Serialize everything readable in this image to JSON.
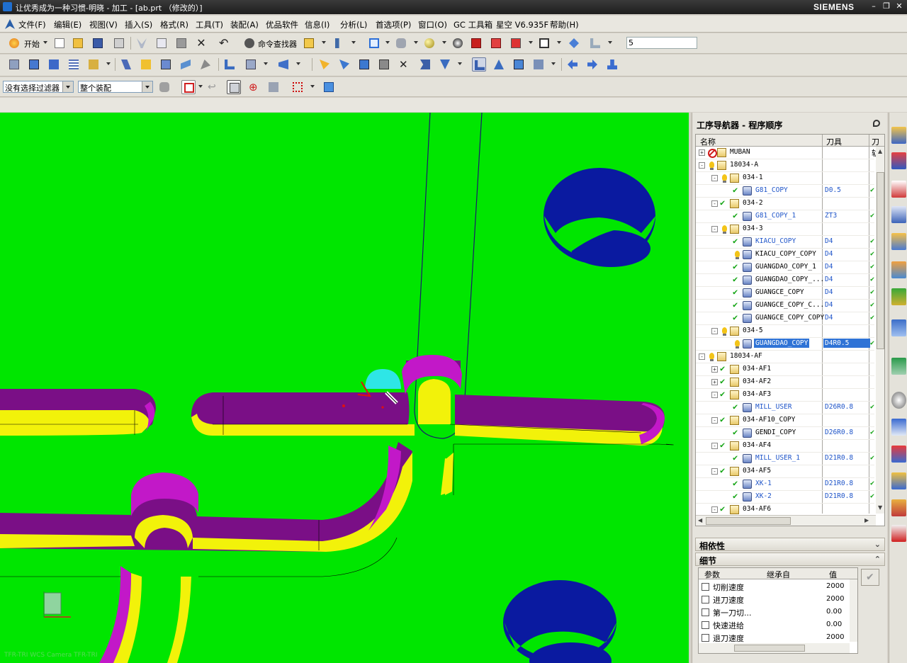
{
  "window": {
    "title": "让优秀成为一种习惯-明晓 - 加工 - [ab.prt （修改的）]",
    "brand": "SIEMENS"
  },
  "menu": [
    "文件(F)",
    "编辑(E)",
    "视图(V)",
    "插入(S)",
    "格式(R)",
    "工具(T)",
    "装配(A)",
    "优品软件",
    "信息(I)",
    "分析(L)",
    "首选项(P)",
    "窗口(O)",
    "GC 工具箱",
    "星空 V6.935F",
    "帮助(H)"
  ],
  "toolbar": {
    "start_label": "开始",
    "command_finder_label": "命令查找器",
    "snap_value": "5"
  },
  "selection_bar": {
    "filter_value": "没有选择过滤器",
    "scope_value": "整个装配"
  },
  "viewport": {
    "status_overlay": "TFR-TRI  WCS  Camera  TFR-TRI"
  },
  "navigator": {
    "title": "工序导航器 - 程序顺序",
    "columns": {
      "name": "名称",
      "tool": "刀具",
      "path": "刀轨"
    },
    "rows": [
      {
        "exp": "+",
        "status": "nomark",
        "icon": "folder",
        "name": "MUBAN",
        "tool": "",
        "level": 0
      },
      {
        "exp": "-",
        "status": "bulb",
        "icon": "folder",
        "name": "18034-A",
        "tool": "",
        "level": 0
      },
      {
        "exp": "-",
        "status": "bulb",
        "icon": "folder",
        "name": "034-1",
        "tool": "",
        "level": 1
      },
      {
        "exp": "",
        "status": "check",
        "icon": "op",
        "name": "G81_COPY",
        "tool": "D0.5",
        "level": 2,
        "blue": true,
        "pm": true
      },
      {
        "exp": "-",
        "status": "check",
        "icon": "folder",
        "name": "034-2",
        "tool": "",
        "level": 1
      },
      {
        "exp": "",
        "status": "check",
        "icon": "op",
        "name": "G81_COPY_1",
        "tool": "ZT3",
        "level": 2,
        "blue": true,
        "pm": true
      },
      {
        "exp": "-",
        "status": "bulb",
        "icon": "folder",
        "name": "034-3",
        "tool": "",
        "level": 1
      },
      {
        "exp": "",
        "status": "check",
        "icon": "op",
        "name": "KIACU_COPY",
        "tool": "D4",
        "level": 2,
        "blue": true,
        "pm": true
      },
      {
        "exp": "",
        "status": "bulb",
        "icon": "op",
        "name": "KIACU_COPY_COPY",
        "tool": "D4",
        "level": 2,
        "pm": true
      },
      {
        "exp": "",
        "status": "check",
        "icon": "op",
        "name": "GUANGDAO_COPY_1",
        "tool": "D4",
        "level": 2,
        "pm": true
      },
      {
        "exp": "",
        "status": "check",
        "icon": "op",
        "name": "GUANGDAO_COPY_...",
        "tool": "D4",
        "level": 2,
        "pm": true
      },
      {
        "exp": "",
        "status": "check",
        "icon": "op",
        "name": "GUANGCE_COPY",
        "tool": "D4",
        "level": 2,
        "pm": true
      },
      {
        "exp": "",
        "status": "check",
        "icon": "op",
        "name": "GUANGCE_COPY_C...",
        "tool": "D4",
        "level": 2,
        "pm": true
      },
      {
        "exp": "",
        "status": "check",
        "icon": "op",
        "name": "GUANGCE_COPY_COPY",
        "tool": "D4",
        "level": 2,
        "pm": true
      },
      {
        "exp": "-",
        "status": "bulb",
        "icon": "folder",
        "name": "034-5",
        "tool": "",
        "level": 1
      },
      {
        "exp": "",
        "status": "bulb",
        "icon": "op",
        "name": "GUANGDAO_COPY",
        "tool": "D4R0.5",
        "level": 2,
        "selected": true,
        "pm": true
      },
      {
        "exp": "-",
        "status": "bulb",
        "icon": "folder",
        "name": "18034-AF",
        "tool": "",
        "level": 0
      },
      {
        "exp": "+",
        "status": "check",
        "icon": "folder",
        "name": "034-AF1",
        "tool": "",
        "level": 1
      },
      {
        "exp": "+",
        "status": "check",
        "icon": "folder",
        "name": "034-AF2",
        "tool": "",
        "level": 1
      },
      {
        "exp": "-",
        "status": "check",
        "icon": "folder",
        "name": "034-AF3",
        "tool": "",
        "level": 1
      },
      {
        "exp": "",
        "status": "check",
        "icon": "op",
        "name": "MILL_USER",
        "tool": "D26R0.8",
        "level": 2,
        "blue": true,
        "pm": true
      },
      {
        "exp": "-",
        "status": "check",
        "icon": "folder",
        "name": "034-AF10_COPY",
        "tool": "",
        "level": 1
      },
      {
        "exp": "",
        "status": "check",
        "icon": "op",
        "name": "GENDI_COPY",
        "tool": "D26R0.8",
        "level": 2,
        "pm": true
      },
      {
        "exp": "-",
        "status": "check",
        "icon": "folder",
        "name": "034-AF4",
        "tool": "",
        "level": 1
      },
      {
        "exp": "",
        "status": "check",
        "icon": "op",
        "name": "MILL_USER_1",
        "tool": "D21R0.8",
        "level": 2,
        "blue": true,
        "pm": true
      },
      {
        "exp": "-",
        "status": "check",
        "icon": "folder",
        "name": "034-AF5",
        "tool": "",
        "level": 1
      },
      {
        "exp": "",
        "status": "check",
        "icon": "op",
        "name": "XK-1",
        "tool": "D21R0.8",
        "level": 2,
        "blue": true,
        "pm": true
      },
      {
        "exp": "",
        "status": "check",
        "icon": "op",
        "name": "XK-2",
        "tool": "D21R0.8",
        "level": 2,
        "blue": true,
        "pm": true
      },
      {
        "exp": "-",
        "status": "check",
        "icon": "folder",
        "name": "034-AF6",
        "tool": "",
        "level": 1
      }
    ]
  },
  "dependencies": {
    "label": "相依性"
  },
  "details": {
    "label": "细节",
    "columns": {
      "param": "参数",
      "inherit": "继承自",
      "value": "值"
    },
    "rows": [
      {
        "param": "切削速度",
        "value": "2000"
      },
      {
        "param": "进刀速度",
        "value": "2000"
      },
      {
        "param": "第一刀切...",
        "value": "0.00"
      },
      {
        "param": "快速进给",
        "value": "0.00"
      },
      {
        "param": "退刀速度",
        "value": "2000"
      }
    ]
  },
  "colors": {
    "viewport_bg": "#00e600",
    "wall_purple": "#7a0f86",
    "wall_magenta": "#c218c8",
    "floor_yellow": "#f2f20a",
    "hole_blue": "#0a1aa0",
    "selection_blue": "#2f73d6"
  }
}
